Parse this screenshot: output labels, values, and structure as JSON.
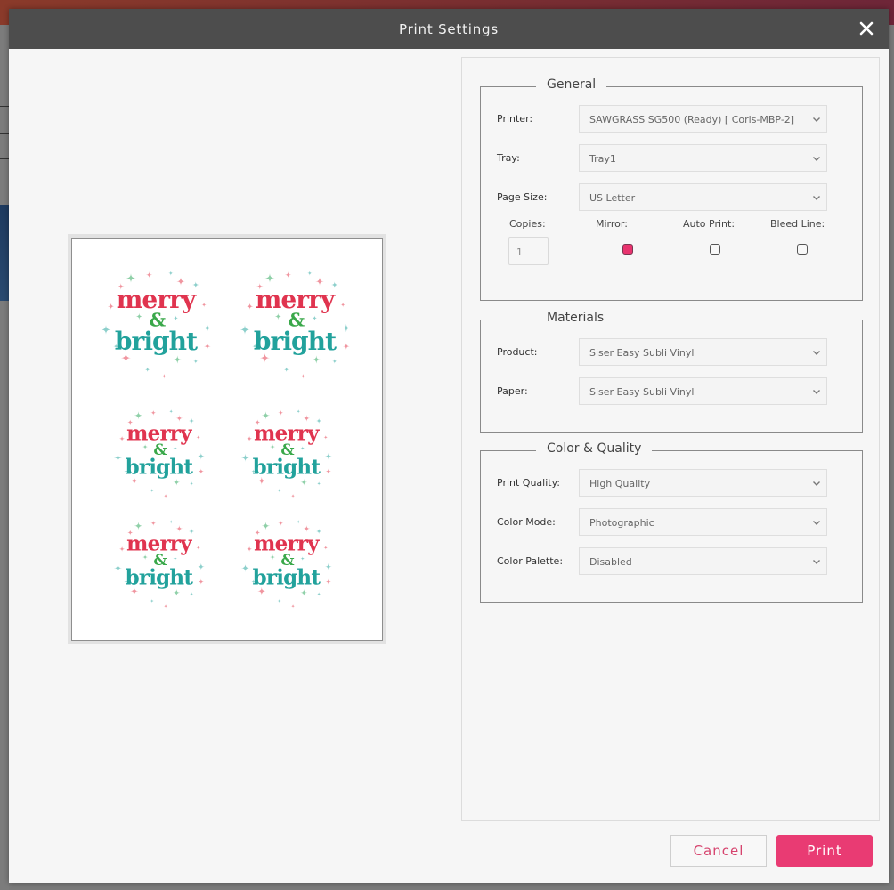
{
  "dialog": {
    "title": "Print Settings",
    "close_icon": "close-icon"
  },
  "preview": {
    "design_text_line1": "merry",
    "design_text_amp": "&",
    "design_text_line2": "bright",
    "design_count": 6,
    "colors": {
      "merry": "#e0344f",
      "amp": "#3aa84a",
      "bright": "#22a29c",
      "sparkle_pink": "#f0959f",
      "sparkle_green": "#8fd0a8",
      "sparkle_teal": "#8ccfcb"
    }
  },
  "general": {
    "legend": "General",
    "printer": {
      "label": "Printer:",
      "value": "SAWGRASS SG500 (Ready) [ Coris-MBP-2]"
    },
    "tray": {
      "label": "Tray:",
      "value": "Tray1"
    },
    "page_size": {
      "label": "Page Size:",
      "value": "US Letter"
    },
    "copies": {
      "label": "Copies:",
      "value": "1"
    },
    "mirror": {
      "label": "Mirror:",
      "checked": true
    },
    "auto_print": {
      "label": "Auto Print:",
      "checked": false
    },
    "bleed_line": {
      "label": "Bleed Line:",
      "checked": false
    }
  },
  "materials": {
    "legend": "Materials",
    "product": {
      "label": "Product:",
      "value": "Siser Easy Subli Vinyl"
    },
    "paper": {
      "label": "Paper:",
      "value": "Siser Easy Subli Vinyl"
    }
  },
  "color_quality": {
    "legend": "Color & Quality",
    "print_quality": {
      "label": "Print Quality:",
      "value": "High Quality"
    },
    "color_mode": {
      "label": "Color Mode:",
      "value": "Photographic"
    },
    "color_palette": {
      "label": "Color Palette:",
      "value": "Disabled"
    }
  },
  "footer": {
    "cancel_label": "Cancel",
    "print_label": "Print"
  },
  "theme": {
    "accent": "#e93b73",
    "header_bg": "#4d4d4d",
    "body_bg": "#f6f6f6"
  }
}
